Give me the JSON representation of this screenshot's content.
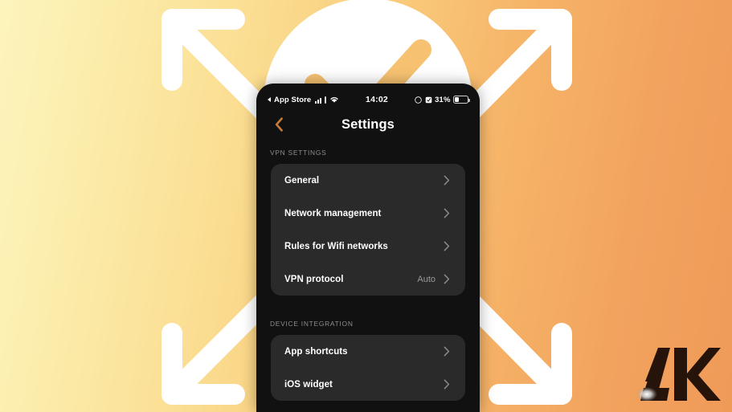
{
  "background": {
    "gradient_start": "#fdf4bd",
    "gradient_end": "#f09a58",
    "graphic_color": "#ffffff",
    "check_color": "#f7c570",
    "arrows_icon": "expand-arrows-icon",
    "check_icon": "check-circle-icon"
  },
  "watermark": {
    "text": "AK",
    "color": "#26130a"
  },
  "phone": {
    "statusbar": {
      "back_app": "App Store",
      "back_icon": "back-triangle-icon",
      "signal_icon": "cellular-signal-icon",
      "wifi_icon": "wifi-icon",
      "time": "14:02",
      "location_icon": "location-arrow-icon",
      "vpn_icon": "vpn-badge-icon",
      "battery_percent": "31%",
      "battery_icon": "battery-icon",
      "battery_level": 31
    },
    "navbar": {
      "back_icon": "chevron-left-icon",
      "back_color": "#c77a3a",
      "title": "Settings"
    },
    "sections": [
      {
        "header": "VPN SETTINGS",
        "rows": [
          {
            "label": "General",
            "value": "",
            "chevron": "chevron-right-icon"
          },
          {
            "label": "Network management",
            "value": "",
            "chevron": "chevron-right-icon"
          },
          {
            "label": "Rules for Wifi networks",
            "value": "",
            "chevron": "chevron-right-icon"
          },
          {
            "label": "VPN protocol",
            "value": "Auto",
            "chevron": "chevron-right-icon"
          }
        ]
      },
      {
        "header": "DEVICE INTEGRATION",
        "rows": [
          {
            "label": "App shortcuts",
            "value": "",
            "chevron": "chevron-right-icon"
          },
          {
            "label": "iOS widget",
            "value": "",
            "chevron": "chevron-right-icon"
          }
        ]
      }
    ]
  }
}
